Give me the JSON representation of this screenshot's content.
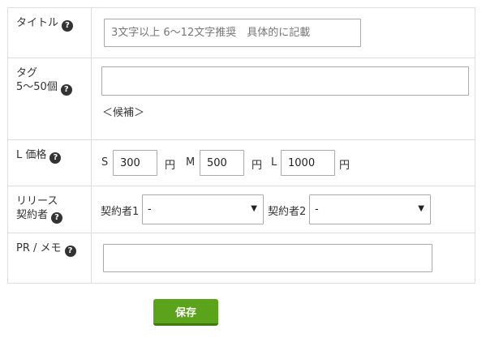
{
  "form": {
    "title": {
      "label": "タイトル",
      "help": "?",
      "placeholder": "3文字以上 6～12文字推奨　具体的に記載",
      "value": ""
    },
    "tag": {
      "label_line1": "タグ",
      "label_line2": "5～50個",
      "help": "?",
      "value": "",
      "candidates_label": "＜候補＞"
    },
    "price": {
      "label": "L 価格",
      "help": "?",
      "fields": [
        {
          "size": "S",
          "value": "300",
          "unit": "円"
        },
        {
          "size": "M",
          "value": "500",
          "unit": "円"
        },
        {
          "size": "L",
          "value": "1000",
          "unit": "円"
        }
      ]
    },
    "release": {
      "label_line1": "リリース",
      "label_line2": "契約者",
      "help": "?",
      "contractors": [
        {
          "label": "契約者1",
          "selected": "-"
        },
        {
          "label": "契約者2",
          "selected": "-"
        }
      ],
      "arrow": "▼"
    },
    "pr": {
      "label": "PR / メモ",
      "help": "?",
      "value": ""
    }
  },
  "actions": {
    "save_label": "保存",
    "accent_color": "#5aa31a"
  }
}
